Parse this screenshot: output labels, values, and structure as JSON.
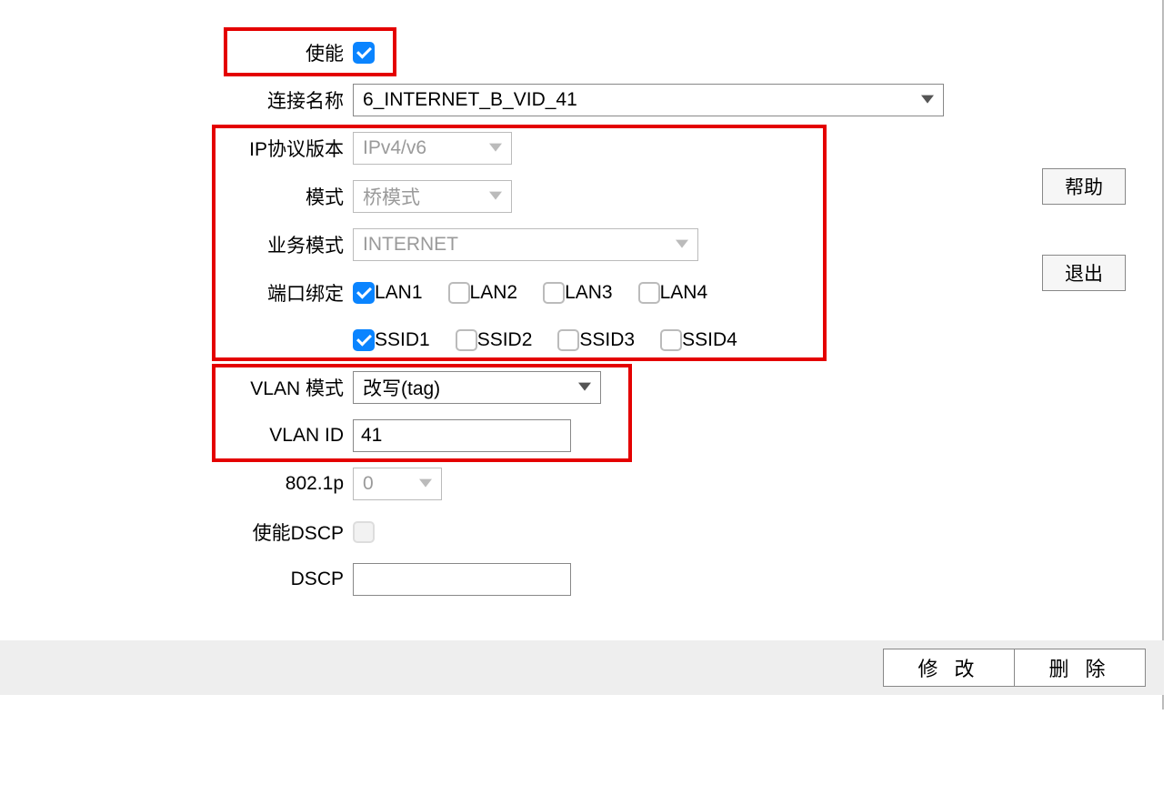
{
  "labels": {
    "enable": "使能",
    "conn_name": "连接名称",
    "ip_proto": "IP协议版本",
    "mode": "模式",
    "service_mode": "业务模式",
    "port_bind": "端口绑定",
    "vlan_mode": "VLAN 模式",
    "vlan_id": "VLAN ID",
    "p8021": "802.1p",
    "enable_dscp": "使能DSCP",
    "dscp": "DSCP"
  },
  "values": {
    "enable": true,
    "conn_name": "6_INTERNET_B_VID_41",
    "ip_proto": "IPv4/v6",
    "mode": "桥模式",
    "service_mode": "INTERNET",
    "ports": {
      "LAN1": true,
      "LAN2": false,
      "LAN3": false,
      "LAN4": false,
      "SSID1": true,
      "SSID2": false,
      "SSID3": false,
      "SSID4": false
    },
    "vlan_mode": "改写(tag)",
    "vlan_id": "41",
    "p8021": "0",
    "enable_dscp": false,
    "dscp": ""
  },
  "port_labels": {
    "LAN1": "LAN1",
    "LAN2": "LAN2",
    "LAN3": "LAN3",
    "LAN4": "LAN4",
    "SSID1": "SSID1",
    "SSID2": "SSID2",
    "SSID3": "SSID3",
    "SSID4": "SSID4"
  },
  "buttons": {
    "help": "帮助",
    "exit": "退出",
    "modify": "修 改",
    "delete": "删 除"
  }
}
